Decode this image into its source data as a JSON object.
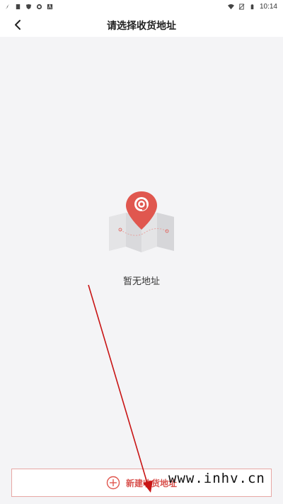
{
  "status_bar": {
    "time": "10:14",
    "left_icons": [
      "flash-icon",
      "sim-icon",
      "shield-icon",
      "gear-icon",
      "a-icon"
    ],
    "right_icons": [
      "wifi-icon",
      "no-sim-icon",
      "battery-icon"
    ]
  },
  "header": {
    "title": "请选择收货地址",
    "back_icon": "back-arrow-icon"
  },
  "empty_state": {
    "message": "暂无地址",
    "illustration": "map-pin-icon"
  },
  "bottom": {
    "add_label": "新建收货地址",
    "icon": "plus-circle-icon"
  },
  "watermark": {
    "text": "www.inhv.cn"
  },
  "colors": {
    "accent": "#e0574f",
    "background": "#f4f4f6",
    "annotation": "#c81414"
  }
}
